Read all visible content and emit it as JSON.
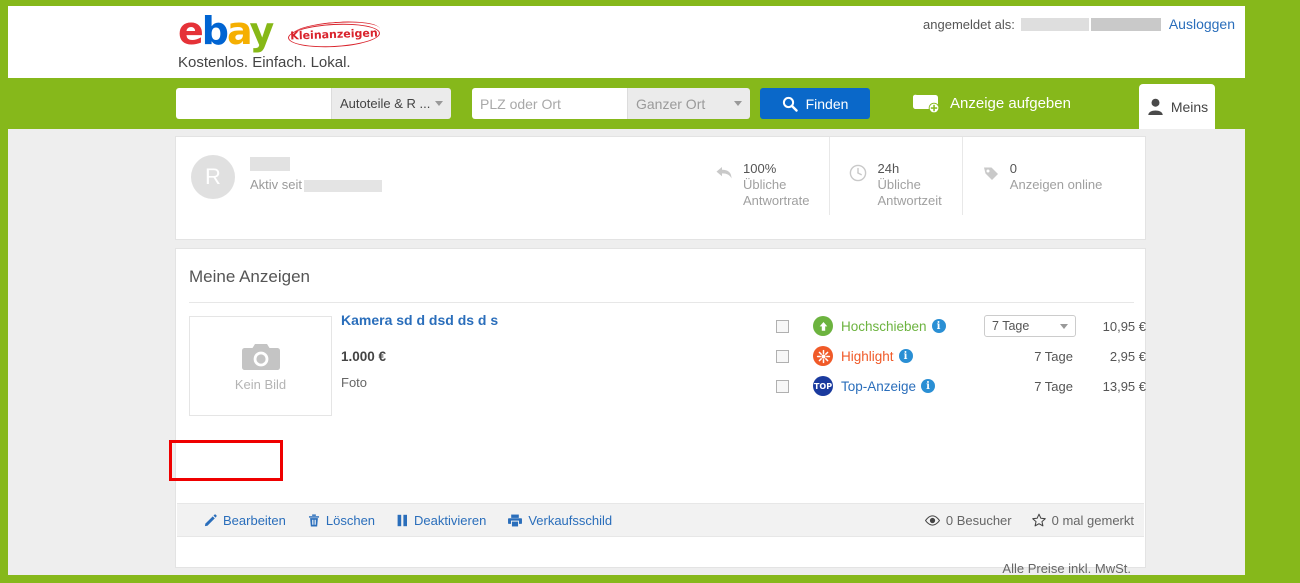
{
  "header": {
    "logo": {
      "e": "e",
      "b": "b",
      "a": "a",
      "y": "y",
      "badge": "Kleinanzeigen"
    },
    "tagline": "Kostenlos. Einfach. Lokal.",
    "login_label": "angemeldet als:",
    "logout_label": "Ausloggen"
  },
  "nav": {
    "keyword_value": "",
    "keyword_placeholder": "",
    "category_label": "Autoteile & R ...",
    "location_value": "",
    "location_placeholder": "PLZ oder Ort",
    "radius_label": "Ganzer Ort",
    "find_label": "Finden",
    "post_ad_label": "Anzeige aufgeben",
    "mine_label": "Meins"
  },
  "profile": {
    "avatar_initial": "R",
    "active_since_label": "Aktiv seit",
    "stats": [
      {
        "value": "100%",
        "line1": "Übliche",
        "line2": "Antwortrate",
        "icon": "reply-icon"
      },
      {
        "value": "24h",
        "line1": "Übliche",
        "line2": "Antwortzeit",
        "icon": "clock-icon"
      },
      {
        "value": "0",
        "line1": "Anzeigen online",
        "line2": "",
        "icon": "tag-icon"
      }
    ]
  },
  "ads": {
    "section_title": "Meine Anzeigen",
    "item": {
      "thumb_label": "Kein Bild",
      "title": "Kamera sd d dsd ds d s",
      "price": "1.000 €",
      "category": "Foto",
      "promotions": [
        {
          "label": "Hochschieben",
          "icon": "arrow-up-circle-icon",
          "duration": "7 Tage",
          "price": "10,95 €",
          "is_select": true,
          "checked": false
        },
        {
          "label": "Highlight",
          "icon": "starburst-icon",
          "duration": "7 Tage",
          "price": "2,95 €",
          "is_select": false,
          "checked": false
        },
        {
          "label": "Top-Anzeige",
          "icon": "top-badge-icon",
          "badge_text": "TOP",
          "duration": "7 Tage",
          "price": "13,95 €",
          "is_select": false,
          "checked": false
        }
      ],
      "actions": [
        {
          "label": "Bearbeiten",
          "icon": "pencil-icon"
        },
        {
          "label": "Löschen",
          "icon": "trash-icon"
        },
        {
          "label": "Deaktivieren",
          "icon": "pause-icon"
        },
        {
          "label": "Verkaufsschild",
          "icon": "printer-icon"
        }
      ],
      "view_stats": [
        {
          "label": "0 Besucher",
          "icon": "eye-icon"
        },
        {
          "label": "0 mal gemerkt",
          "icon": "star-icon"
        }
      ]
    },
    "vat_note": "Alle Preise inkl. MwSt."
  },
  "colors": {
    "brand_green": "#86b81b",
    "link_blue": "#2a6ebb",
    "button_blue": "#0a68c9",
    "highlight_red": "#ef0000"
  }
}
